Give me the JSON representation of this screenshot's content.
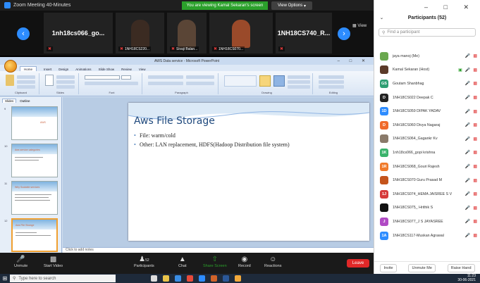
{
  "zoom": {
    "title": "Zoom Meeting 40-Minutes",
    "share_banner": "You are viewing Kamal Sekaran's screen",
    "view_options": "View Options",
    "view_label": "View",
    "tiles": [
      {
        "label": "1nh18cs066_go...",
        "name": ""
      },
      {
        "label": "",
        "name": "1NH18CS220..."
      },
      {
        "label": "",
        "name": "Sivaji Balan..."
      },
      {
        "label": "",
        "name": "1NH18CS070..."
      },
      {
        "label": "1NH18CS740_R...",
        "name": ""
      }
    ]
  },
  "ppt": {
    "window_title": "AWS Data service - Microsoft PowerPoint",
    "tabs": [
      "Home",
      "Insert",
      "Design",
      "Animations",
      "Slide Show",
      "Review",
      "View"
    ],
    "groups": [
      "Clipboard",
      "Slides",
      "Font",
      "Paragraph",
      "Drawing",
      "Editing"
    ],
    "pane_tabs": [
      "Slides",
      "Outline"
    ],
    "thumbnails": [
      {
        "num": "9",
        "title": "AWS"
      },
      {
        "num": "10",
        "title": "Aws service categories"
      },
      {
        "num": "11",
        "title": "Why Scalable services"
      },
      {
        "num": "12",
        "title": "Aws File Storage"
      }
    ],
    "slide": {
      "title": "Aws File Storage",
      "bullets": [
        "File: warm/cold",
        "Other: LAN replacement, HDFS(Hadoop Distribution file system)"
      ]
    },
    "notes_placeholder": "Click to add notes"
  },
  "controls": {
    "unmute": "Unmute",
    "start_video": "Start Video",
    "participants": "Participants",
    "participant_count": "52",
    "chat": "Chat",
    "share_screen": "Share Screen",
    "record": "Record",
    "reactions": "Reactions",
    "leave": "Leave"
  },
  "panel": {
    "title": "Participants (52)",
    "search_placeholder": "Find a participant",
    "participants": [
      {
        "name": "jaya manoj (Me)",
        "initials": "",
        "color": "#6aa84f"
      },
      {
        "name": "Kamal Sekaran (Host)",
        "initials": "",
        "color": "#5b3a29"
      },
      {
        "name": "Goutam Shanbhag",
        "initials": "GS",
        "color": "#2e9e72"
      },
      {
        "name": "1NH18CS022 Deepak C",
        "initials": "D",
        "color": "#222222"
      },
      {
        "name": "1NH18CS059 DIPAK YADAV",
        "initials": "1D",
        "color": "#2d8cff"
      },
      {
        "name": "1NH18CS060 Divya Nagaraj",
        "initials": "D",
        "color": "#f06a2a"
      },
      {
        "name": "1NH18CS064_Gagankr Kv",
        "initials": "",
        "color": "#8a7a6a"
      },
      {
        "name": "1nh18cs066_gopi krishna",
        "initials": "1K",
        "color": "#39b36b"
      },
      {
        "name": "1NH18CS068_Gouri Rajesh",
        "initials": "1R",
        "color": "#f07a2a"
      },
      {
        "name": "1NH18CS070 Guru Prasad M",
        "initials": "",
        "color": "#c4541c"
      },
      {
        "name": "1NH18CS074_HEMA JAISREE S V",
        "initials": "1J",
        "color": "#d63a3a"
      },
      {
        "name": "1NH18CS075_ Hrithik S",
        "initials": "",
        "color": "#111111"
      },
      {
        "name": "1NH18CS077_J S JAYASREE",
        "initials": "J",
        "color": "#b04ac4"
      },
      {
        "name": "1NH18CS117-Muskan Agrawal",
        "initials": "1A",
        "color": "#2d8cff"
      }
    ],
    "invite": "Invite",
    "unmute_me": "Unmute Me",
    "raise_hand": "Raise Hand"
  },
  "taskbar": {
    "search_placeholder": "Type here to search",
    "time": "11:23",
    "date": "30-06-2021"
  }
}
